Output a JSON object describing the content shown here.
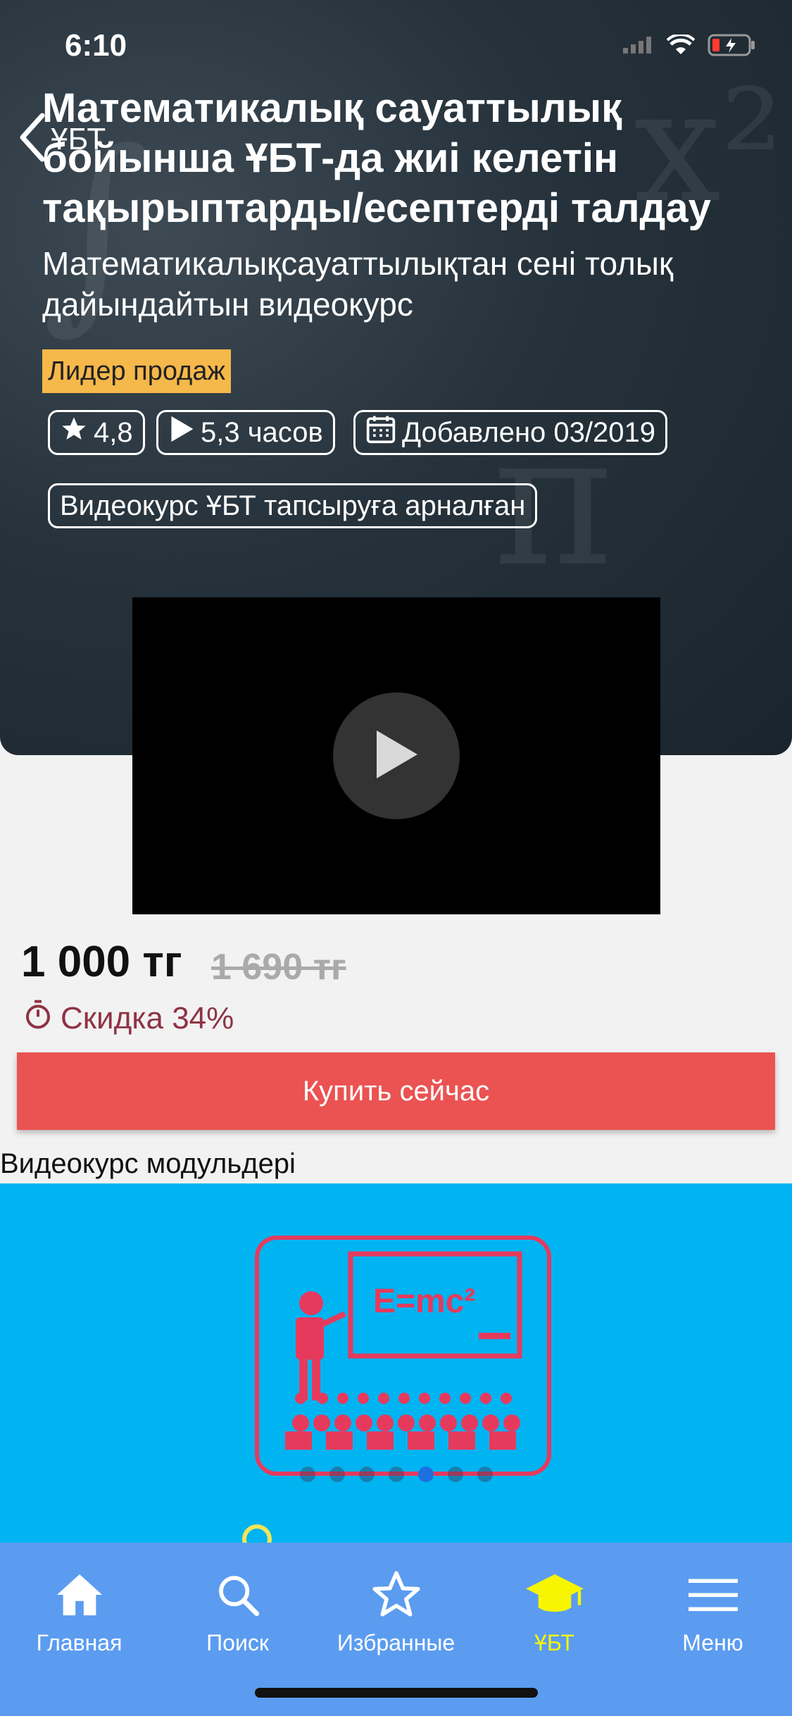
{
  "status": {
    "time": "6:10"
  },
  "header": {
    "back_label": "ҰБТ"
  },
  "course": {
    "title": "Математикалық сауаттылық бойынша ҰБТ-да жиі келетін тақырыптарды/есептерді талдау",
    "subtitle": "Математикалықсауаттылықтан сені толық дайындайтын видеокурс",
    "badge": "Лидер продаж",
    "rating": "4,8",
    "duration": "5,3 часов",
    "added": "Добавлено 03/2019",
    "tag": "Видеокурс ҰБТ тапсыруға арналған"
  },
  "pricing": {
    "price": "1 000 тг",
    "old_price": "1 690 тг",
    "discount": "Скидка 34%",
    "buy_label": "Купить сейчас"
  },
  "modules": {
    "title": "Видеокурс модульдері",
    "slide_count": 7,
    "active_slide": 5,
    "banner_formula": "E=mc²"
  },
  "tabs": [
    {
      "label": "Главная",
      "icon": "home-icon"
    },
    {
      "label": "Поиск",
      "icon": "search-icon"
    },
    {
      "label": "Избранные",
      "icon": "star-icon"
    },
    {
      "label": "ҰБТ",
      "icon": "graduation-cap-icon",
      "active": true
    },
    {
      "label": "Меню",
      "icon": "menu-icon"
    }
  ],
  "colors": {
    "accent_badge": "#f5b84a",
    "buy_button": "#ea5352",
    "tabbar": "#5b9cf0",
    "active_tab": "#f7f600",
    "banner": "#00b3f1",
    "discount": "#8e3344"
  }
}
